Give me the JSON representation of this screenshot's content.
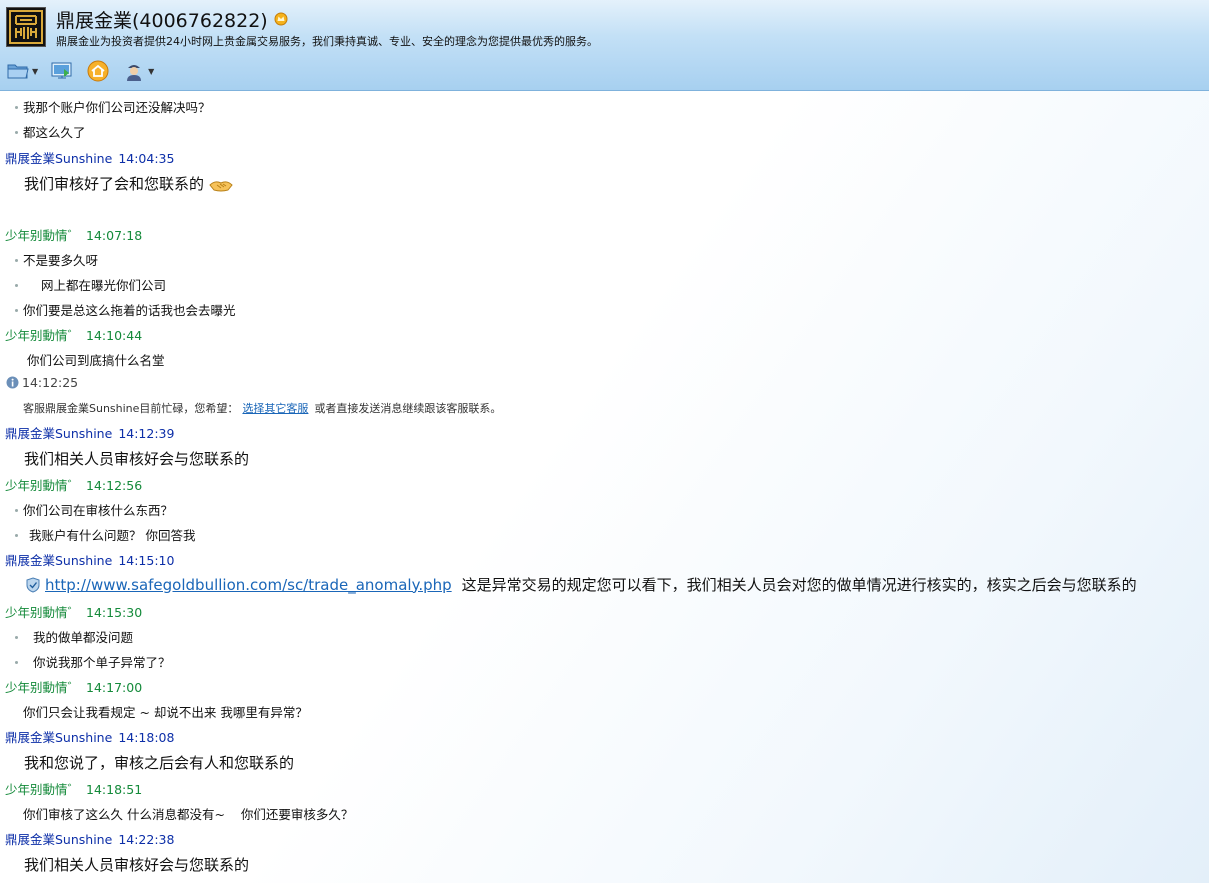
{
  "header": {
    "title": "鼎展金業(4006762822)",
    "subtitle": "鼎展金业为投资者提供24小时网上贵金属交易服务，我们秉持真诚、专业、安全的理念为您提供最优秀的服务。",
    "logo_icon": "ding-logo-icon",
    "badge_icon": "crown-badge-icon"
  },
  "toolbar": {
    "items": [
      {
        "icon": "folder-icon",
        "has_dropdown": true
      },
      {
        "icon": "screen-transfer-icon",
        "has_dropdown": false
      },
      {
        "icon": "home-icon",
        "has_dropdown": false
      },
      {
        "icon": "agent-icon",
        "has_dropdown": true
      }
    ]
  },
  "chat": {
    "m1": "我那个账户你们公司还没解决吗？",
    "m2": "都这么久了",
    "h1": {
      "sender": "鼎展金業Sunshine",
      "time": "14:04:35"
    },
    "m3": "我们审核好了会和您联系的",
    "h2": {
      "sender": "少年别動情゛",
      "time": "14:07:18"
    },
    "m4": "不是要多久呀",
    "m5": "网上都在曝光你们公司",
    "m6": "你们要是总这么拖着的话我也会去曝光",
    "h3": {
      "sender": "少年别動情゛",
      "time": "14:10:44"
    },
    "m7": "你们公司到底搞什么名堂",
    "sys": {
      "time": "14:12:25",
      "before": "客服鼎展金業Sunshine目前忙碌，您希望：",
      "link": "选择其它客服",
      "after": "或者直接发送消息继续跟该客服联系。"
    },
    "h4": {
      "sender": "鼎展金業Sunshine",
      "time": "14:12:39"
    },
    "m8": "我们相关人员审核好会与您联系的",
    "h5": {
      "sender": "少年别動情゛",
      "time": "14:12:56"
    },
    "m9": "你们公司在审核什么东西？",
    "m10": "我账户有什么问题？  你回答我",
    "h6": {
      "sender": "鼎展金業Sunshine",
      "time": "14:15:10"
    },
    "url": "http://www.safegoldbullion.com/sc/trade_anomaly.php",
    "url_text": "这是异常交易的规定您可以看下，我们相关人员会对您的做单情况进行核实的，核实之后会与您联系的",
    "h7": {
      "sender": "少年别動情゛",
      "time": "14:15:30"
    },
    "m11": "我的做单都没问题",
    "m12": "你说我那个单子异常了？",
    "h8": {
      "sender": "少年别動情゛",
      "time": "14:17:00"
    },
    "m13": "你们只会让我看规定 ~ 却说不出来 我哪里有异常？",
    "h9": {
      "sender": "鼎展金業Sunshine",
      "time": "14:18:08"
    },
    "m14": "我和您说了，审核之后会有人和您联系的",
    "h10": {
      "sender": "少年别動情゛",
      "time": "14:18:51"
    },
    "m15": "你们审核了这么久 什么消息都没有~    你们还要审核多久？",
    "h11": {
      "sender": "鼎展金業Sunshine",
      "time": "14:22:38"
    },
    "m16": "我们相关人员审核好会与您联系的"
  },
  "colors": {
    "agent": "#0d2fa8",
    "user": "#148a3a",
    "link": "#1a66b8",
    "header_top": "#e4f1fb",
    "header_bottom": "#a7d0f0"
  }
}
